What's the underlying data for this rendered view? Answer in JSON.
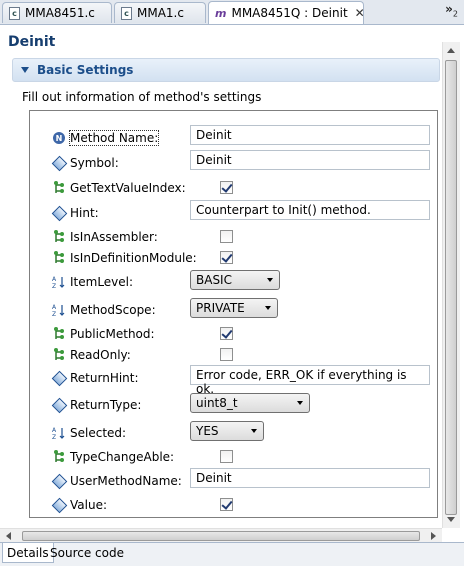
{
  "tabs": [
    {
      "label": "MMA8451.c",
      "active": false
    },
    {
      "label": "MMA1.c",
      "active": false
    },
    {
      "label": "MMA8451Q : Deinit",
      "active": true
    }
  ],
  "tab_overflow": {
    "symbol": "»",
    "count": "2"
  },
  "page_title": "Deinit",
  "section_title": "Basic Settings",
  "description": "Fill out information of method's settings",
  "properties": [
    {
      "icon": "info-icon",
      "label": "Method Name:",
      "type": "text",
      "value": "Deinit"
    },
    {
      "icon": "diamond-icon",
      "label": "Symbol:",
      "type": "text",
      "value": "Deinit"
    },
    {
      "icon": "tree-icon",
      "label": "GetTextValueIndex:",
      "type": "checkbox",
      "checked": true
    },
    {
      "icon": "diamond-icon",
      "label": "Hint:",
      "type": "text",
      "value": "Counterpart to Init() method."
    },
    {
      "icon": "tree-icon",
      "label": "IsInAssembler:",
      "type": "checkbox",
      "checked": false
    },
    {
      "icon": "tree-icon",
      "label": "IsInDefinitionModule:",
      "type": "checkbox",
      "checked": true
    },
    {
      "icon": "sort-icon",
      "label": "ItemLevel:",
      "type": "select",
      "value": "BASIC"
    },
    {
      "icon": "sort-icon",
      "label": "MethodScope:",
      "type": "select",
      "value": "PRIVATE"
    },
    {
      "icon": "tree-icon",
      "label": "PublicMethod:",
      "type": "checkbox",
      "checked": true
    },
    {
      "icon": "tree-icon",
      "label": "ReadOnly:",
      "type": "checkbox",
      "checked": false
    },
    {
      "icon": "diamond-icon",
      "label": "ReturnHint:",
      "type": "text",
      "value": "Error code, ERR_OK if everything is ok."
    },
    {
      "icon": "diamond-icon",
      "label": "ReturnType:",
      "type": "select",
      "value": "uint8_t"
    },
    {
      "icon": "sort-icon",
      "label": "Selected:",
      "type": "select",
      "value": "YES"
    },
    {
      "icon": "tree-icon",
      "label": "TypeChangeAble:",
      "type": "checkbox",
      "checked": false
    },
    {
      "icon": "diamond-icon",
      "label": "UserMethodName:",
      "type": "text",
      "value": "Deinit"
    },
    {
      "icon": "diamond-icon",
      "label": "Value:",
      "type": "checkbox",
      "checked": true
    }
  ],
  "bottom_tabs": [
    {
      "label": "Details",
      "active": true
    },
    {
      "label": "Source code",
      "active": false
    }
  ],
  "colors": {
    "title": "#163e6f",
    "section": "#1c4e8a",
    "icon_blue": "#1d4f91"
  }
}
